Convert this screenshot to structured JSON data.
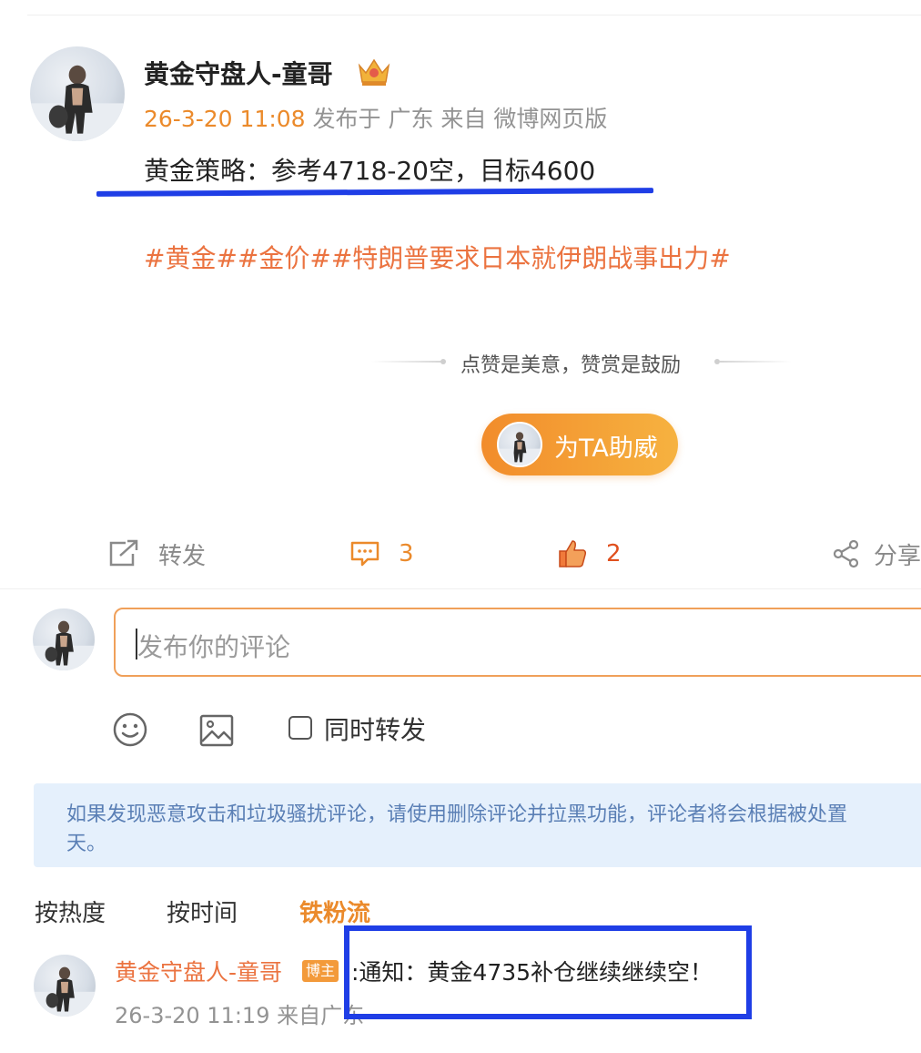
{
  "post": {
    "author": "黄金守盘人-童哥",
    "time": "26-3-20 11:08",
    "meta_suffix": " 发布于 广东 来自 微博网页版",
    "text": "黄金策略：参考4718-20空，目标4600",
    "topics": "#黄金##金价##特朗普要求日本就伊朗战事出力#"
  },
  "reward": {
    "slogan": "点赞是美意，赞赏是鼓励",
    "button_label": "为TA助威"
  },
  "actions": {
    "repost_label": "转发",
    "comment_count": "3",
    "like_count": "2",
    "share_label": "分享"
  },
  "compose": {
    "placeholder": "发布你的评论",
    "repost_checkbox_label": "同时转发"
  },
  "notice": {
    "line1": "如果发现恶意攻击和垃圾骚扰评论，请使用删除评论并拉黑功能，评论者将会根据被处置",
    "line2": "天。"
  },
  "sort_tabs": {
    "hot": "按热度",
    "time": "按时间",
    "fans": "铁粉流"
  },
  "comments": [
    {
      "author": "黄金守盘人-童哥",
      "badge": "博主",
      "text": ":通知：黄金4735补仓继续继续空！",
      "meta": "26-3-20 11:19 来自广东"
    }
  ],
  "colors": {
    "accent_orange": "#eb8a2b",
    "topic_orange": "#eb7340",
    "annotation_blue": "#1f3ee6",
    "notice_bg": "#e5f0fc"
  },
  "icons": {
    "crown": "crown-icon",
    "repost": "repost-icon",
    "comment": "comment-icon",
    "like": "thumbs-up-icon",
    "share": "share-icon",
    "emoji": "emoji-icon",
    "image": "image-icon"
  }
}
